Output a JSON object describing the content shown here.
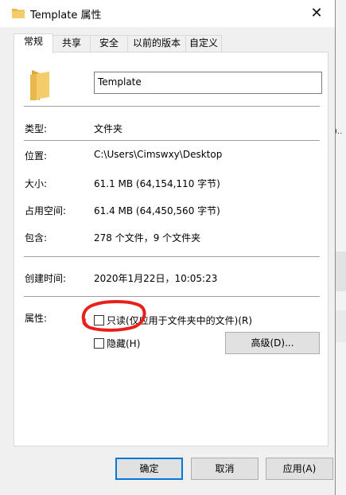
{
  "window": {
    "title": "Template 属性",
    "close_symbol": "✕"
  },
  "tabs": [
    {
      "label": "常规",
      "active": true
    },
    {
      "label": "共享",
      "active": false
    },
    {
      "label": "安全",
      "active": false
    },
    {
      "label": "以前的版本",
      "active": false
    },
    {
      "label": "自定义",
      "active": false
    }
  ],
  "general": {
    "name_value": "Template",
    "rows": {
      "type": {
        "label": "类型:",
        "value": "文件夹"
      },
      "location": {
        "label": "位置:",
        "value": "C:\\Users\\Cimswxy\\Desktop"
      },
      "size": {
        "label": "大小:",
        "value": "61.1 MB (64,154,110 字节)"
      },
      "size_on_disk": {
        "label": "占用空间:",
        "value": "61.4 MB (64,450,560 字节)"
      },
      "contains": {
        "label": "包含:",
        "value": "278 个文件，9 个文件夹"
      },
      "created": {
        "label": "创建时间:",
        "value": "2020年1月22日，10:05:23"
      }
    },
    "attributes": {
      "label": "属性:",
      "readonly_label": "只读(仅应用于文件夹中的文件)(R)",
      "readonly_checked": false,
      "hidden_label": "隐藏(H)",
      "hidden_checked": false,
      "advanced_label": "高级(D)..."
    }
  },
  "buttons": {
    "ok": "确定",
    "cancel": "取消",
    "apply": "应用(A)"
  },
  "background": {
    "fragment_text": ").."
  },
  "colors": {
    "folder": "#e8b84a",
    "annotation": "#e8201c",
    "default_button_border": "#0078d7"
  },
  "icons": {
    "title": "folder-icon",
    "main": "folder-icon",
    "close": "close-icon"
  }
}
